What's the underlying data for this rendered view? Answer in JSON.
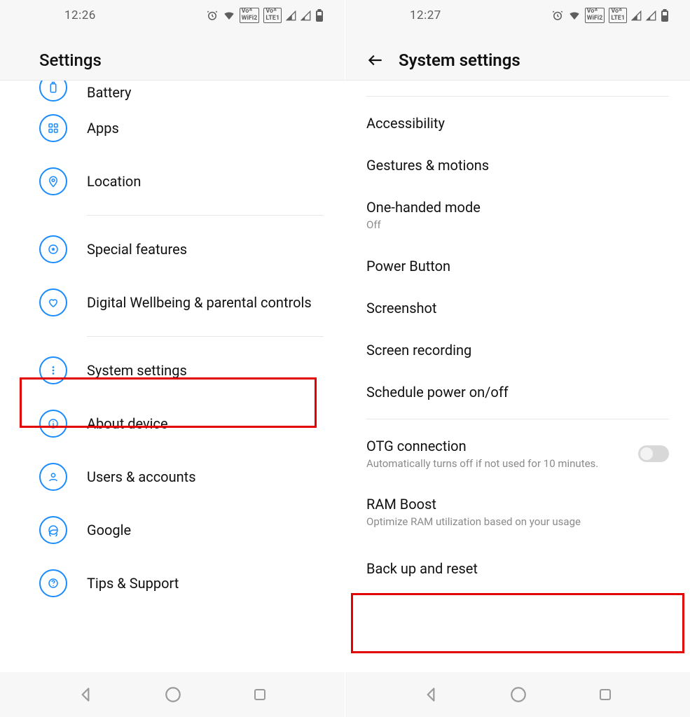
{
  "left": {
    "time": "12:26",
    "title": "Settings",
    "items": [
      {
        "icon": "battery",
        "label": "Battery"
      },
      {
        "icon": "apps",
        "label": "Apps"
      },
      {
        "icon": "location",
        "label": "Location"
      },
      {
        "icon": "star",
        "label": "Special features"
      },
      {
        "icon": "heart",
        "label": "Digital Wellbeing & parental controls"
      },
      {
        "icon": "dots",
        "label": "System settings",
        "highlight": true
      },
      {
        "icon": "info",
        "label": "About device"
      },
      {
        "icon": "user",
        "label": "Users & accounts"
      },
      {
        "icon": "google",
        "label": "Google"
      },
      {
        "icon": "help",
        "label": "Tips & Support"
      }
    ]
  },
  "right": {
    "time": "12:27",
    "title": "System settings",
    "items": [
      {
        "title": "Accessibility"
      },
      {
        "title": "Gestures & motions"
      },
      {
        "title": "One-handed mode",
        "sub": "Off"
      },
      {
        "title": "Power Button"
      },
      {
        "title": "Screenshot"
      },
      {
        "title": "Screen recording"
      },
      {
        "title": "Schedule power on/off"
      },
      {
        "title": "OTG connection",
        "sub": "Automatically turns off if not used for 10 minutes.",
        "toggle": true
      },
      {
        "title": "RAM Boost",
        "sub": "Optimize RAM utilization based on your usage"
      },
      {
        "title": "Back up and reset",
        "highlight": true
      }
    ],
    "status_badges": {
      "vowifi": "Vo^ WiFi2",
      "volte": "Vo^ LTE1"
    }
  }
}
